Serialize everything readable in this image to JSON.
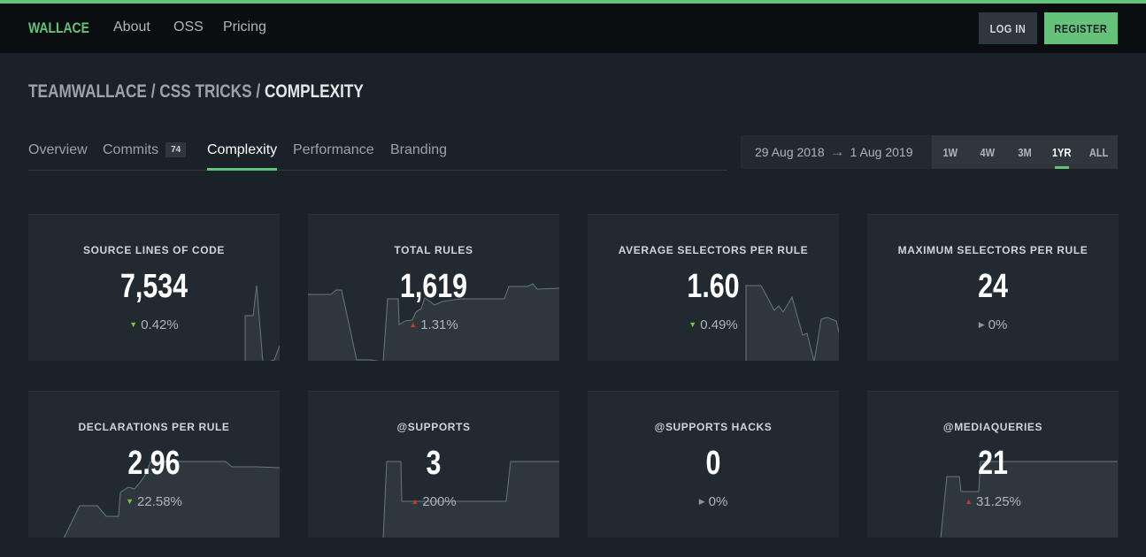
{
  "nav": {
    "logo": "WALLACE",
    "links": [
      "About",
      "OSS",
      "Pricing"
    ],
    "login": "LOG IN",
    "register": "REGISTER"
  },
  "breadcrumb": {
    "org": "TEAMWALLACE",
    "project": "CSS TRICKS",
    "page": "COMPLEXITY",
    "separator": "/"
  },
  "tabs": [
    {
      "label": "Overview"
    },
    {
      "label": "Commits",
      "badge": "74"
    },
    {
      "label": "Complexity",
      "active": true
    },
    {
      "label": "Performance"
    },
    {
      "label": "Branding"
    }
  ],
  "range": {
    "from": "29 Aug 2018",
    "arrow": "→",
    "to": "1 Aug 2019"
  },
  "periods": [
    {
      "label": "1W"
    },
    {
      "label": "4W"
    },
    {
      "label": "3M"
    },
    {
      "label": "1YR",
      "active": true
    },
    {
      "label": "ALL"
    }
  ],
  "colors": {
    "accent": "#64c27b",
    "down_good": "#7cc43a",
    "up_bad": "#c0392b",
    "neutral": "#8a9398"
  },
  "cards": [
    {
      "title": "SOURCE LINES OF CODE",
      "value": "7,534",
      "delta": "0.42%",
      "trend": "down"
    },
    {
      "title": "TOTAL RULES",
      "value": "1,619",
      "delta": "1.31%",
      "trend": "up"
    },
    {
      "title": "AVERAGE SELECTORS PER RULE",
      "value": "1.60",
      "delta": "0.49%",
      "trend": "down"
    },
    {
      "title": "MAXIMUM SELECTORS PER RULE",
      "value": "24",
      "delta": "0%",
      "trend": "flat"
    },
    {
      "title": "DECLARATIONS PER RULE",
      "value": "2.96",
      "delta": "22.58%",
      "trend": "down"
    },
    {
      "title": "@SUPPORTS",
      "value": "3",
      "delta": "200%",
      "trend": "up"
    },
    {
      "title": "@SUPPORTS HACKS",
      "value": "0",
      "delta": "0%",
      "trend": "flat"
    },
    {
      "title": "@MEDIAQUERIES",
      "value": "21",
      "delta": "31.25%",
      "trend": "up"
    }
  ]
}
